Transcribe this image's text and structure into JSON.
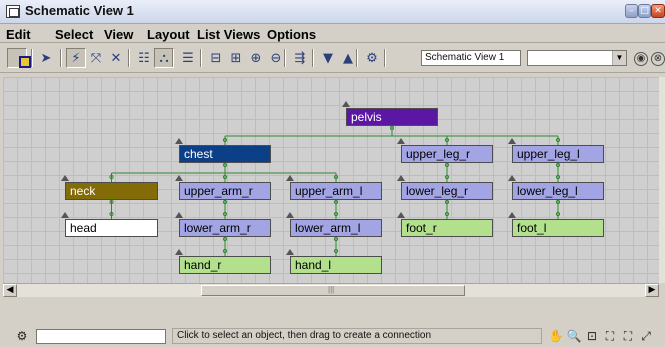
{
  "window": {
    "title": "Schematic View 1"
  },
  "menu": [
    "Edit",
    "Select",
    "View",
    "Layout",
    "List Views",
    "Options"
  ],
  "toolbar": {
    "tools": [
      {
        "name": "display-floater-icon",
        "glyph": ""
      },
      {
        "name": "select-arrow-icon",
        "glyph": "➤"
      },
      {
        "name": "connect-icon",
        "glyph": "⚡"
      },
      {
        "name": "unlink-icon",
        "glyph": "⤧"
      },
      {
        "name": "delete-icon",
        "glyph": "✕"
      },
      {
        "name": "hierarchy-mode-icon",
        "glyph": "☷"
      },
      {
        "name": "references-mode-icon",
        "glyph": "⛬"
      },
      {
        "name": "list-mode-icon",
        "glyph": "☰"
      },
      {
        "name": "align-left-icon",
        "glyph": "⊟"
      },
      {
        "name": "align-right-icon",
        "glyph": "⊞"
      },
      {
        "name": "expand-icon",
        "glyph": "⊕"
      },
      {
        "name": "collapse-icon",
        "glyph": "⊖"
      },
      {
        "name": "arrange-icon",
        "glyph": "⇶"
      },
      {
        "name": "filter-down-icon",
        "glyph": "▼"
      },
      {
        "name": "filter-up-icon",
        "glyph": "▲"
      },
      {
        "name": "preferences-icon",
        "glyph": "⚙"
      }
    ],
    "view_name": "Schematic View 1",
    "views_combo": ""
  },
  "nodes": [
    {
      "id": "pelvis",
      "label": "pelvis",
      "color": "sel"
    },
    {
      "id": "chest",
      "label": "chest",
      "color": "dkblue"
    },
    {
      "id": "upper_leg_r",
      "label": "upper_leg_r",
      "color": "lav"
    },
    {
      "id": "upper_leg_l",
      "label": "upper_leg_l",
      "color": "lav"
    },
    {
      "id": "neck",
      "label": "neck",
      "color": "olive"
    },
    {
      "id": "upper_arm_r",
      "label": "upper_arm_r",
      "color": "lav"
    },
    {
      "id": "upper_arm_l",
      "label": "upper_arm_l",
      "color": "lav"
    },
    {
      "id": "lower_leg_r",
      "label": "lower_leg_r",
      "color": "lav"
    },
    {
      "id": "lower_leg_l",
      "label": "lower_leg_l",
      "color": "lav"
    },
    {
      "id": "head",
      "label": "head",
      "color": "white"
    },
    {
      "id": "lower_arm_r",
      "label": "lower_arm_r",
      "color": "lav"
    },
    {
      "id": "lower_arm_l",
      "label": "lower_arm_l",
      "color": "lav"
    },
    {
      "id": "foot_r",
      "label": "foot_r",
      "color": "grn"
    },
    {
      "id": "foot_l",
      "label": "foot_l",
      "color": "grn"
    },
    {
      "id": "hand_r",
      "label": "hand_r",
      "color": "grn"
    },
    {
      "id": "hand_l",
      "label": "hand_l",
      "color": "grn"
    }
  ],
  "links": [
    [
      "pelvis",
      "chest"
    ],
    [
      "pelvis",
      "upper_leg_r"
    ],
    [
      "pelvis",
      "upper_leg_l"
    ],
    [
      "chest",
      "neck"
    ],
    [
      "chest",
      "upper_arm_r"
    ],
    [
      "chest",
      "upper_arm_l"
    ],
    [
      "neck",
      "head"
    ],
    [
      "upper_arm_r",
      "lower_arm_r"
    ],
    [
      "upper_arm_l",
      "lower_arm_l"
    ],
    [
      "lower_arm_r",
      "hand_r"
    ],
    [
      "lower_arm_l",
      "hand_l"
    ],
    [
      "upper_leg_r",
      "lower_leg_r"
    ],
    [
      "upper_leg_l",
      "lower_leg_l"
    ],
    [
      "lower_leg_r",
      "foot_r"
    ],
    [
      "lower_leg_l",
      "foot_l"
    ]
  ],
  "colors": {
    "selected": "#5b17a3",
    "chest": "#0b3f88",
    "neck": "#836c08",
    "bone": "#a2a4e4",
    "end_effector": "#b2e08c",
    "link": "#2f8a2f"
  },
  "status": {
    "field": "",
    "prompt": "Click to select an object, then drag to create a connection",
    "nav_tools": [
      {
        "name": "pan-hand-icon",
        "glyph": "✋"
      },
      {
        "name": "zoom-icon",
        "glyph": "🔍"
      },
      {
        "name": "zoom-region-icon",
        "glyph": "⊡"
      },
      {
        "name": "zoom-extents-icon",
        "glyph": "⛶"
      },
      {
        "name": "zoom-extents-selected-icon",
        "glyph": "⛶"
      },
      {
        "name": "zoom-all-icon",
        "glyph": "⤢"
      }
    ]
  }
}
